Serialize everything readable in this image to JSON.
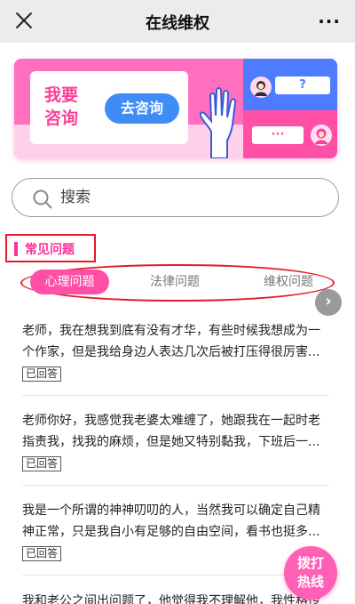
{
  "header": {
    "title": "在线维权",
    "more_label": "···"
  },
  "banner": {
    "text": "我要咨询",
    "button_label": "去咨询",
    "question_bubble": "?",
    "reply_bubble": "···"
  },
  "search": {
    "placeholder": "搜索"
  },
  "section": {
    "title": "常见问题"
  },
  "tabs": [
    {
      "label": "心理问题",
      "active": true
    },
    {
      "label": "法律问题",
      "active": false
    },
    {
      "label": "维权问题",
      "active": false
    }
  ],
  "tab_next_label": "›",
  "questions": [
    {
      "text": "老师，我在想我到底有没有才华，有些时候我想成为一个作家，但是我给身边人表达几次后被打压得很厉害...",
      "status": "已回答"
    },
    {
      "text": "老师你好，我感觉我老婆太难缠了，她跟我在一起时老指责我，找我的麻烦，但是她又特别黏我，下班后一...",
      "status": "已回答"
    },
    {
      "text": "我是一个所谓的神神叨叨的人，当然我可以确定自己精神正常，只是我自小有足够的自由空间，看书也挺多...",
      "status": "已回答"
    },
    {
      "text": "我和老公之间出问题了，他觉得我不理解他，我性格传",
      "status": ""
    }
  ],
  "hotline": {
    "line1": "拨打",
    "line2": "热线"
  },
  "colors": {
    "brand_pink": "#ff4fa6",
    "accent_blue": "#3f8cf6",
    "annotation_red": "#e31b2c"
  }
}
